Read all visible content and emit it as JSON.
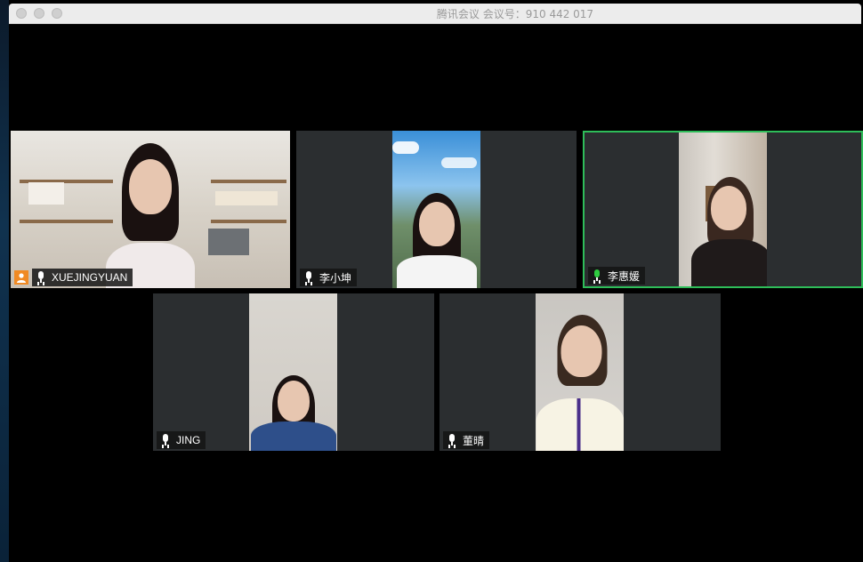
{
  "window": {
    "title": "腾讯会议 会议号：910 442 017"
  },
  "participants": [
    {
      "name": "XUEJINGYUAN",
      "host": true,
      "speaking": false
    },
    {
      "name": "李小坤",
      "host": false,
      "speaking": false
    },
    {
      "name": "李惠媛",
      "host": false,
      "speaking": true
    },
    {
      "name": "JING",
      "host": false,
      "speaking": false
    },
    {
      "name": "董晴",
      "host": false,
      "speaking": false
    }
  ],
  "colors": {
    "active_border": "#2ebd59",
    "host_badge": "#f08a24",
    "tile_bg": "#2b2e30"
  },
  "icons": {
    "mic": "microphone-icon",
    "host": "host-person-icon"
  }
}
